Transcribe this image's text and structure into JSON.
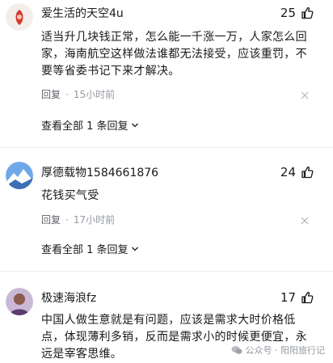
{
  "comments": [
    {
      "username": "爱生活的天空4u",
      "likes": "25",
      "content": "适当升几块钱正常，怎么能一千涨一万，人家怎么回家，海南航空这样做法谁都无法接受，应该重罚，不要等省委书记下来才解决。",
      "reply_label": "回复",
      "time": "15小时前",
      "view_replies": "查看全部 1 条回复"
    },
    {
      "username": "厚德载物1584661876",
      "likes": "24",
      "content": "花钱买气受",
      "reply_label": "回复",
      "time": "17小时前",
      "view_replies": "查看全部 1 条回复"
    },
    {
      "username": "极速海浪fz",
      "likes": "17",
      "content": "中国人做生意就是有问题，应该是需求大时价格低点，体现薄利多销，反而是需求小的时候更便宜，永远是宰客思维。"
    }
  ],
  "watermark": "公众号 · 阳阳旅行记",
  "colors": {
    "text": "#18191c",
    "secondary": "#61666d",
    "muted": "#9499a0",
    "divider": "#e9eaec"
  }
}
